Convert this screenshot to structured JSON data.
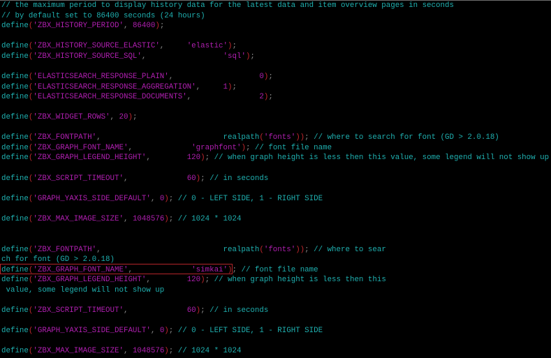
{
  "terminal": {
    "lines": [
      {
        "segments": [
          [
            "cm",
            "// the maximum period to display history data for the latest data and item overview pages in seconds"
          ]
        ]
      },
      {
        "segments": [
          [
            "cm",
            "// by default set to 86400 seconds (24 hours)"
          ]
        ]
      },
      {
        "segments": [
          [
            "kw",
            "define"
          ],
          [
            "pr",
            "("
          ],
          [
            "st",
            "'ZBX_HISTORY_PERIOD'"
          ],
          [
            "pu",
            ", "
          ],
          [
            "st",
            "86400"
          ],
          [
            "pr",
            ")"
          ],
          [
            "pu",
            ";"
          ]
        ]
      },
      {
        "segments": []
      },
      {
        "segments": [
          [
            "kw",
            "define"
          ],
          [
            "pr",
            "("
          ],
          [
            "st",
            "'ZBX_HISTORY_SOURCE_ELASTIC'"
          ],
          [
            "pu",
            ",     "
          ],
          [
            "st",
            "'elastic'"
          ],
          [
            "pr",
            ")"
          ],
          [
            "pu",
            ";"
          ]
        ]
      },
      {
        "segments": [
          [
            "kw",
            "define"
          ],
          [
            "pr",
            "("
          ],
          [
            "st",
            "'ZBX_HISTORY_SOURCE_SQL'"
          ],
          [
            "pu",
            ",                 "
          ],
          [
            "st",
            "'sql'"
          ],
          [
            "pr",
            ")"
          ],
          [
            "pu",
            ";"
          ]
        ]
      },
      {
        "segments": []
      },
      {
        "segments": [
          [
            "kw",
            "define"
          ],
          [
            "pr",
            "("
          ],
          [
            "st",
            "'ELASTICSEARCH_RESPONSE_PLAIN'"
          ],
          [
            "pu",
            ",                   "
          ],
          [
            "st",
            "0"
          ],
          [
            "pr",
            ")"
          ],
          [
            "pu",
            ";"
          ]
        ]
      },
      {
        "segments": [
          [
            "kw",
            "define"
          ],
          [
            "pr",
            "("
          ],
          [
            "st",
            "'ELASTICSEARCH_RESPONSE_AGGREGATION'"
          ],
          [
            "pu",
            ",     "
          ],
          [
            "st",
            "1"
          ],
          [
            "pr",
            ")"
          ],
          [
            "pu",
            ";"
          ]
        ]
      },
      {
        "segments": [
          [
            "kw",
            "define"
          ],
          [
            "pr",
            "("
          ],
          [
            "st",
            "'ELASTICSEARCH_RESPONSE_DOCUMENTS'"
          ],
          [
            "pu",
            ",               "
          ],
          [
            "st",
            "2"
          ],
          [
            "pr",
            ")"
          ],
          [
            "pu",
            ";"
          ]
        ]
      },
      {
        "segments": []
      },
      {
        "segments": [
          [
            "kw",
            "define"
          ],
          [
            "pr",
            "("
          ],
          [
            "st",
            "'ZBX_WIDGET_ROWS'"
          ],
          [
            "pu",
            ", "
          ],
          [
            "st",
            "20"
          ],
          [
            "pr",
            ")"
          ],
          [
            "pu",
            ";"
          ]
        ]
      },
      {
        "segments": []
      },
      {
        "segments": [
          [
            "kw",
            "define"
          ],
          [
            "pr",
            "("
          ],
          [
            "st",
            "'ZBX_FONTPATH'"
          ],
          [
            "pu",
            ",                           "
          ],
          [
            "kw",
            "realpath"
          ],
          [
            "pr",
            "("
          ],
          [
            "st",
            "'fonts'"
          ],
          [
            "pr",
            "))"
          ],
          [
            "pu",
            ";"
          ],
          [
            "cm",
            " // where to search for font (GD > 2.0.18)"
          ]
        ]
      },
      {
        "segments": [
          [
            "kw",
            "define"
          ],
          [
            "pr",
            "("
          ],
          [
            "st",
            "'ZBX_GRAPH_FONT_NAME'"
          ],
          [
            "pu",
            ",             "
          ],
          [
            "st",
            "'graphfont'"
          ],
          [
            "pr",
            ")"
          ],
          [
            "pu",
            ";"
          ],
          [
            "cm",
            " // font file name"
          ]
        ]
      },
      {
        "segments": [
          [
            "kw",
            "define"
          ],
          [
            "pr",
            "("
          ],
          [
            "st",
            "'ZBX_GRAPH_LEGEND_HEIGHT'"
          ],
          [
            "pu",
            ",        "
          ],
          [
            "st",
            "120"
          ],
          [
            "pr",
            ")"
          ],
          [
            "pu",
            ";"
          ],
          [
            "cm",
            " // when graph height is less then this value, some legend will not show up"
          ]
        ]
      },
      {
        "segments": []
      },
      {
        "segments": [
          [
            "kw",
            "define"
          ],
          [
            "pr",
            "("
          ],
          [
            "st",
            "'ZBX_SCRIPT_TIMEOUT'"
          ],
          [
            "pu",
            ",             "
          ],
          [
            "st",
            "60"
          ],
          [
            "pr",
            ")"
          ],
          [
            "pu",
            ";"
          ],
          [
            "cm",
            " // in seconds"
          ]
        ]
      },
      {
        "segments": []
      },
      {
        "segments": [
          [
            "kw",
            "define"
          ],
          [
            "pr",
            "("
          ],
          [
            "st",
            "'GRAPH_YAXIS_SIDE_DEFAULT'"
          ],
          [
            "pu",
            ", "
          ],
          [
            "st",
            "0"
          ],
          [
            "pr",
            ")"
          ],
          [
            "pu",
            ";"
          ],
          [
            "cm",
            " // 0 - LEFT SIDE, 1 - RIGHT SIDE"
          ]
        ]
      },
      {
        "segments": []
      },
      {
        "segments": [
          [
            "kw",
            "define"
          ],
          [
            "pr",
            "("
          ],
          [
            "st",
            "'ZBX_MAX_IMAGE_SIZE'"
          ],
          [
            "pu",
            ", "
          ],
          [
            "st",
            "1048576"
          ],
          [
            "pr",
            ")"
          ],
          [
            "pu",
            ";"
          ],
          [
            "cm",
            " // 1024 * 1024"
          ]
        ]
      },
      {
        "segments": []
      },
      {
        "segments": []
      },
      {
        "segments": [
          [
            "kw",
            "define"
          ],
          [
            "pr",
            "("
          ],
          [
            "st",
            "'ZBX_FONTPATH'"
          ],
          [
            "pu",
            ",                           "
          ],
          [
            "kw",
            "realpath"
          ],
          [
            "pr",
            "("
          ],
          [
            "st",
            "'fonts'"
          ],
          [
            "pr",
            "))"
          ],
          [
            "pu",
            ";"
          ],
          [
            "cm",
            " // where to sear"
          ]
        ]
      },
      {
        "segments": [
          [
            "cm",
            "ch for font (GD > 2.0.18)"
          ]
        ]
      },
      {
        "segments": [
          [
            "kw",
            "define"
          ],
          [
            "pr",
            "("
          ],
          [
            "st",
            "'ZBX_GRAPH_FONT_NAME'"
          ],
          [
            "pu",
            ",             "
          ],
          [
            "st",
            "'simkai'"
          ],
          [
            "pr",
            ")"
          ],
          [
            "pu",
            ";"
          ],
          [
            "cm",
            " // font file name"
          ]
        ]
      },
      {
        "segments": [
          [
            "kw",
            "define"
          ],
          [
            "pr",
            "("
          ],
          [
            "st",
            "'ZBX_GRAPH_LEGEND_HEIGHT'"
          ],
          [
            "pu",
            ",        "
          ],
          [
            "st",
            "120"
          ],
          [
            "pr",
            ")"
          ],
          [
            "pu",
            ";"
          ],
          [
            "cm",
            " // when graph height is less then this"
          ]
        ]
      },
      {
        "segments": [
          [
            "cm",
            " value, some legend will not show up"
          ]
        ]
      },
      {
        "segments": []
      },
      {
        "segments": [
          [
            "kw",
            "define"
          ],
          [
            "pr",
            "("
          ],
          [
            "st",
            "'ZBX_SCRIPT_TIMEOUT'"
          ],
          [
            "pu",
            ",             "
          ],
          [
            "st",
            "60"
          ],
          [
            "pr",
            ")"
          ],
          [
            "pu",
            ";"
          ],
          [
            "cm",
            " // in seconds"
          ]
        ]
      },
      {
        "segments": []
      },
      {
        "segments": [
          [
            "kw",
            "define"
          ],
          [
            "pr",
            "("
          ],
          [
            "st",
            "'GRAPH_YAXIS_SIDE_DEFAULT'"
          ],
          [
            "pu",
            ", "
          ],
          [
            "st",
            "0"
          ],
          [
            "pr",
            ")"
          ],
          [
            "pu",
            ";"
          ],
          [
            "cm",
            " // 0 - LEFT SIDE, 1 - RIGHT SIDE"
          ]
        ]
      },
      {
        "segments": []
      },
      {
        "segments": [
          [
            "kw",
            "define"
          ],
          [
            "pr",
            "("
          ],
          [
            "st",
            "'ZBX_MAX_IMAGE_SIZE'"
          ],
          [
            "pu",
            ", "
          ],
          [
            "st",
            "1048576"
          ],
          [
            "pr",
            ")"
          ],
          [
            "pu",
            ";"
          ],
          [
            "cm",
            " // 1024 * 1024"
          ]
        ]
      }
    ],
    "highlighted_line_index": 26,
    "colors": {
      "background": "#000000",
      "keyword": "#1fb0b0",
      "comment": "#1fb0b0",
      "string": "#b01fb0",
      "paren": "#c2272d",
      "punct": "#8a8a8a",
      "highlight_box": "#b5252a"
    }
  }
}
